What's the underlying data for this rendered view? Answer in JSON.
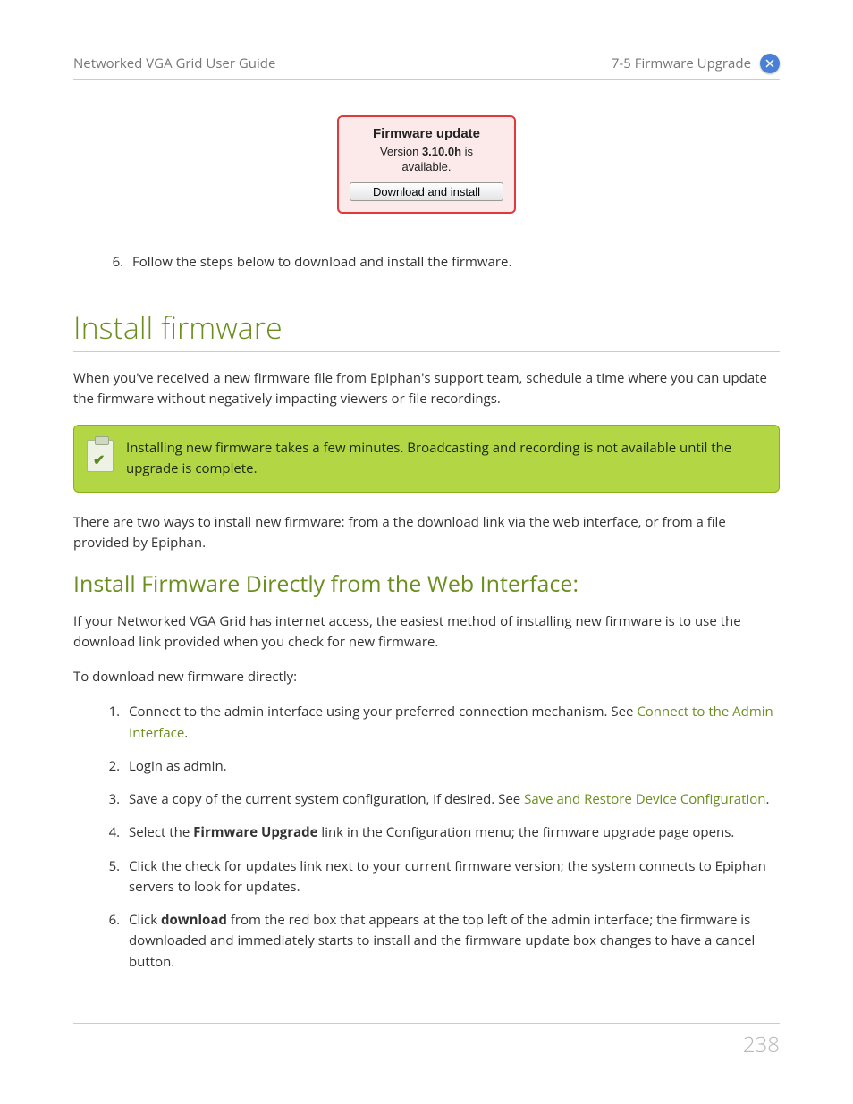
{
  "header": {
    "left": "Networked VGA Grid User Guide",
    "right": "7-5 Firmware Upgrade"
  },
  "firmware_box": {
    "title": "Firmware update",
    "version_prefix": "Version ",
    "version": "3.10.0h",
    "version_suffix": " is",
    "available": "available.",
    "button": "Download and install"
  },
  "top_step": {
    "num_start": 6,
    "text": "Follow the steps below to download and install the firmware."
  },
  "h1": "Install firmware",
  "intro": "When you've received a new firmware file from Epiphan's support team, schedule a time where you can update the firmware without negatively impacting viewers or file recordings.",
  "note": "Installing new firmware takes a few minutes. Broadcasting and recording is not available until the upgrade is complete.",
  "para2": "There are two ways to install new firmware: from a the download link via the web interface, or from a file provided by Epiphan.",
  "h2": "Install Firmware Directly from the Web Interface:",
  "para3": "If your Networked VGA Grid has internet access, the easiest method of installing new firmware is to use the download link provided when you check for new firmware.",
  "para4": "To download new firmware directly:",
  "steps": {
    "s1_a": "Connect to the admin interface using your preferred connection mechanism. See ",
    "s1_link": "Connect to the Admin Interface",
    "s1_b": ".",
    "s2": "Login as admin.",
    "s3_a": "Save a copy of the current system configuration, if desired. See ",
    "s3_link": "Save and Restore Device Configuration",
    "s3_b": ".",
    "s4_a": "Select the ",
    "s4_bold": "Firmware Upgrade",
    "s4_b": " link in the Configuration menu; the firmware upgrade page opens.",
    "s5": "Click the check for updates link next to your current firmware version; the system connects to Epiphan servers to look for updates.",
    "s6_a": "Click ",
    "s6_bold": "download",
    "s6_b": " from the red box that appears at the top left of the admin interface; the firmware is downloaded and immediately starts to install and the firmware update box changes to have a cancel button."
  },
  "page_number": "238"
}
